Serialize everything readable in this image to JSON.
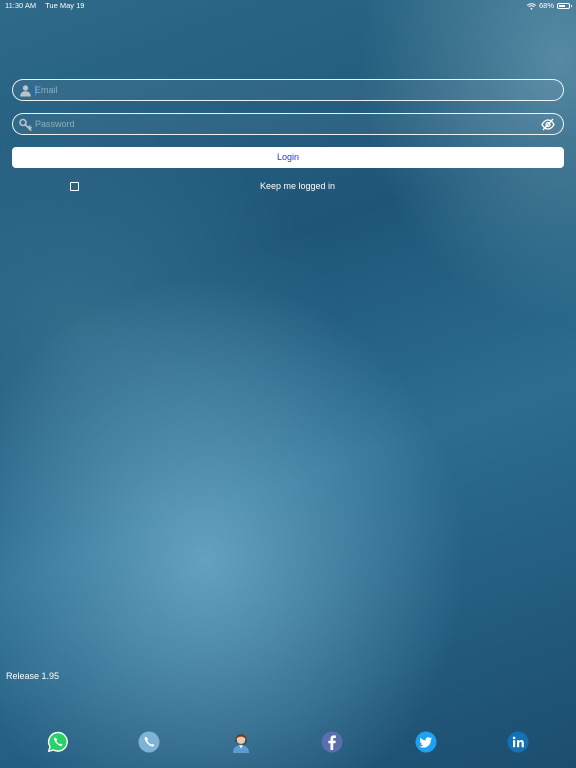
{
  "status_bar": {
    "time": "11:30 AM",
    "date": "Tue May 19",
    "battery": "68%"
  },
  "login_form": {
    "email_placeholder": "Email",
    "password_placeholder": "Password",
    "login_label": "Login",
    "keep_logged_in_label": "Keep me logged in"
  },
  "footer": {
    "release": "Release 1.95",
    "social_icons": [
      "whatsapp-icon",
      "phone-icon",
      "support-agent-icon",
      "facebook-icon",
      "twitter-icon",
      "linkedin-icon"
    ]
  },
  "colors": {
    "login_text": "#2a35d8",
    "whatsapp": "#25d366",
    "phone": "#7fb3d5",
    "facebook": "#5b6fb0",
    "twitter": "#1da1f2",
    "linkedin": "#1173b6"
  }
}
